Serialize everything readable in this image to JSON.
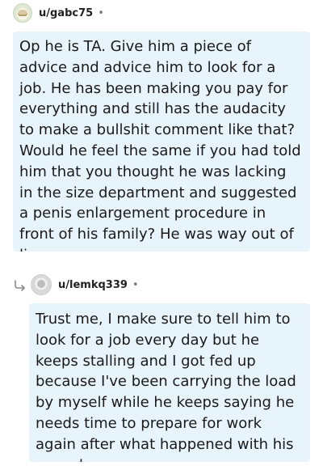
{
  "comments": [
    {
      "username": "u/gabc75",
      "separator": "•",
      "avatar_icon": "avatar-icon",
      "text": "Op he is TA. Give him a piece of advice and advice him to look for a job. He has been making you pay for everything and still has the audacity to make a bullshit comment like that? Would he feel the same if you had told him that you thought he was lacking in the size department and suggested a penis enlargement procedure in front of his family? He was way out of line."
    },
    {
      "username": "u/lemkq339",
      "separator": "•",
      "avatar_icon": "avatar-icon",
      "reply_icon": "reply-arrow-icon",
      "text": "Trust me, I make sure to tell him to look for a job every day but he keeps stalling and I got fed up because I've been carrying the load by myself while he keeps saying he needs time to prepare for work again after what happened with his coworker."
    }
  ],
  "colors": {
    "bubble_background": "#e8f4fb",
    "text": "#1a1a1b",
    "separator": "#787c7e"
  }
}
